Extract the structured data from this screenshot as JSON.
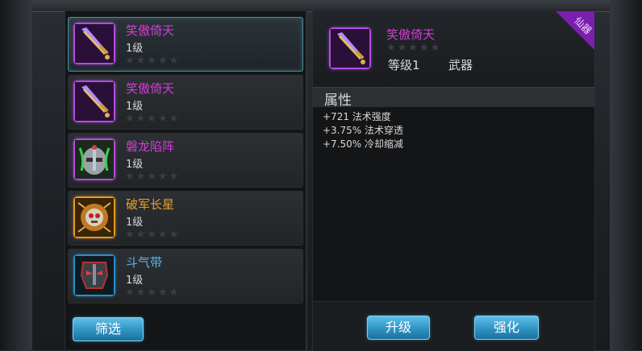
{
  "colors": {
    "epic": "#d03fd6",
    "legendary": "#e8a02a",
    "rare": "#5fb4e8",
    "button": "#2e93c4"
  },
  "item_list": [
    {
      "name": "笑傲倚天",
      "level": "1级",
      "stars": "★★★★★",
      "icon": "purple-sword-icon",
      "selected": true
    },
    {
      "name": "笑傲倚天",
      "level": "1级",
      "stars": "★★★★★",
      "icon": "purple-sword-icon",
      "selected": false
    },
    {
      "name": "磐龙陷阵",
      "level": "1级",
      "stars": "★★★★★",
      "icon": "dragon-helmet-icon",
      "selected": false
    },
    {
      "name": "破军长星",
      "level": "1级",
      "stars": "★★★★★",
      "icon": "skull-amulet-icon",
      "selected": false
    },
    {
      "name": "斗气带",
      "level": "1级",
      "stars": "★★★★★",
      "icon": "mask-belt-icon",
      "selected": false
    }
  ],
  "filter_label": "筛选",
  "detail": {
    "corner_tag": "仙器",
    "name": "笑傲倚天",
    "stars": "★★★★★",
    "level": "等级1",
    "type": "武器",
    "icon": "purple-sword-icon",
    "attributes_title": "属性",
    "attributes": [
      "+721 法术强度",
      "+3.75% 法术穿透",
      "+7.50% 冷却缩减"
    ]
  },
  "actions": {
    "upgrade_label": "升级",
    "enhance_label": "强化"
  }
}
